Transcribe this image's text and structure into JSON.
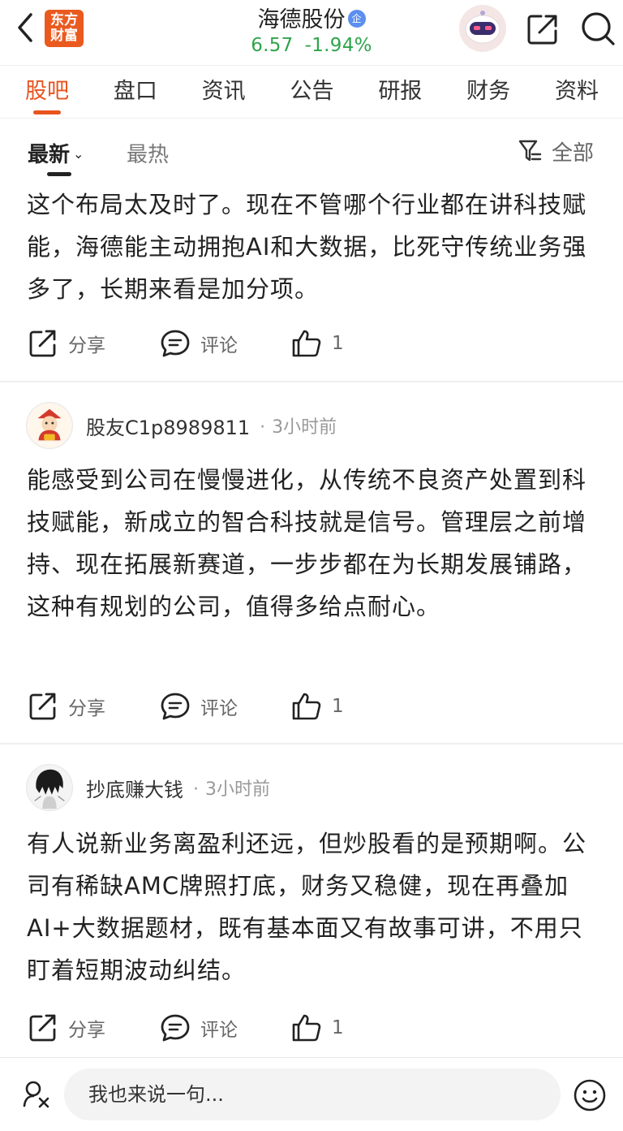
{
  "header": {
    "logo_text_line1": "东方",
    "logo_text_line2": "财富",
    "stock_name": "海德股份",
    "verified_badge": "企",
    "price": "6.57",
    "change_pct": "-1.94%",
    "price_color": "#2fa44b"
  },
  "tabs": [
    {
      "label": "股吧",
      "active": true
    },
    {
      "label": "盘口"
    },
    {
      "label": "资讯"
    },
    {
      "label": "公告"
    },
    {
      "label": "研报"
    },
    {
      "label": "财务"
    },
    {
      "label": "资料"
    }
  ],
  "sort": {
    "newest": "最新",
    "hottest": "最热",
    "filter_label": "全部"
  },
  "posts": [
    {
      "author": "",
      "time": "",
      "content": "这个布局太及时了。现在不管哪个行业都在讲科技赋能，海德能主动拥抱AI和大数据，比死守传统业务强多了，长期来看是加分项。",
      "share_label": "分享",
      "comment_label": "评论",
      "likes": "1"
    },
    {
      "author": "股友C1p8989811",
      "time": "3小时前",
      "content": "能感受到公司在慢慢进化，从传统不良资产处置到科技赋能，新成立的智合科技就是信号。管理层之前增持、现在拓展新赛道，一步步都在为长期发展铺路，这种有规划的公司，值得多给点耐心。",
      "share_label": "分享",
      "comment_label": "评论",
      "likes": "1"
    },
    {
      "author": "抄底赚大钱",
      "time": "3小时前",
      "content": "有人说新业务离盈利还远，但炒股看的是预期啊。公司有稀缺AMC牌照打底，财务又稳健，现在再叠加AI+大数据题材，既有基本面又有故事可讲，不用只盯着短期波动纠结。",
      "share_label": "分享",
      "comment_label": "评论",
      "likes": "1"
    }
  ],
  "bottom": {
    "input_placeholder": "我也来说一句..."
  },
  "colors": {
    "accent": "#e8541e",
    "logo": "#ea5a1f"
  }
}
